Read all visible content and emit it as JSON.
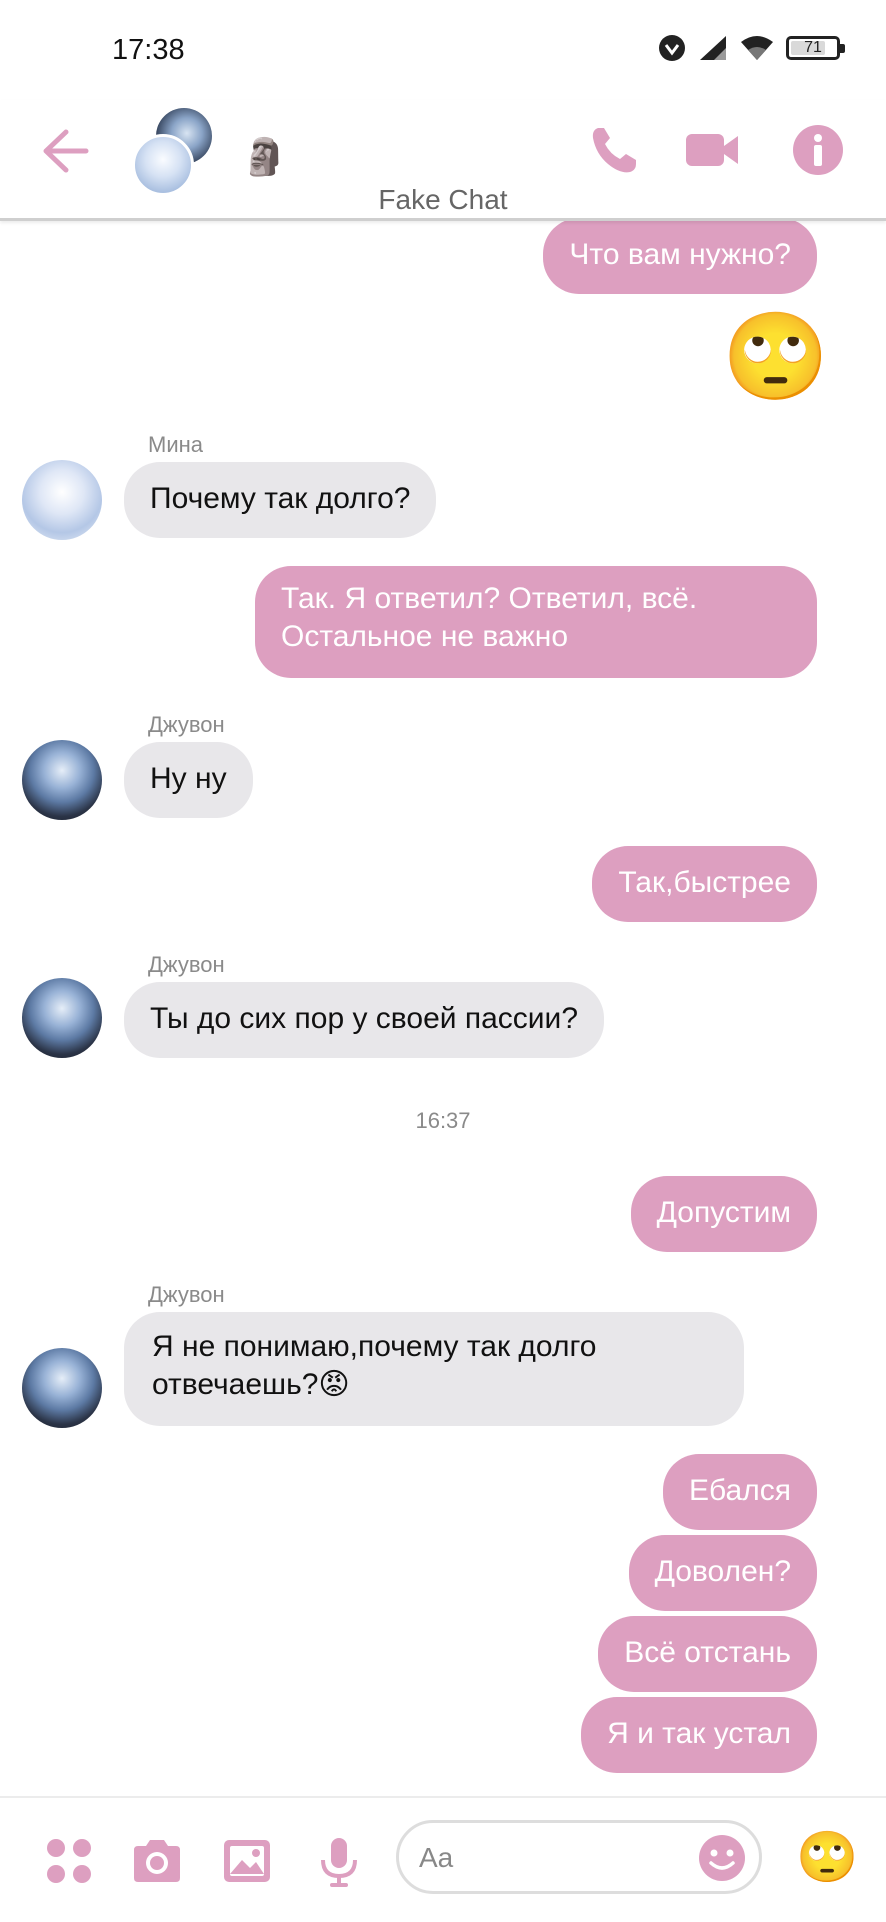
{
  "status_bar": {
    "time": "17:38",
    "battery": "71"
  },
  "header": {
    "title": "Fake Chat",
    "moai_emoji": "🗿"
  },
  "accent_color": "#dd9fc0",
  "messages": [
    {
      "dir": "out",
      "text": "Что вам нужно?"
    },
    {
      "dir": "out",
      "emoji": "🙄"
    },
    {
      "sender": "Мина",
      "dir": "in",
      "text": "Почему так долго?"
    },
    {
      "dir": "out",
      "text_line1": "Так. Я ответил? Ответил, всё.",
      "text_line2": "Остальное не важно"
    },
    {
      "sender": "Джувон",
      "dir": "in",
      "text": "Ну ну"
    },
    {
      "dir": "out",
      "text": "Так,быстрее"
    },
    {
      "sender": "Джувон",
      "dir": "in",
      "text": "Ты до сих пор у своей пассии?"
    },
    {
      "timestamp": "16:37"
    },
    {
      "dir": "out",
      "text": "Допустим"
    },
    {
      "sender": "Джувон",
      "dir": "in",
      "text_line1": "Я не понимаю,почему так долго",
      "text_line2": "отвечаешь?😡"
    },
    {
      "dir": "out",
      "text": "Ебался"
    },
    {
      "dir": "out",
      "text": "Доволен?"
    },
    {
      "dir": "out",
      "text": "Всё отстань"
    },
    {
      "dir": "out",
      "text": "Я и так устал"
    }
  ],
  "composer": {
    "placeholder": "Aa",
    "quick_emoji": "🙄"
  },
  "icons": [
    "back-arrow-icon",
    "phone-icon",
    "video-camera-icon",
    "info-icon",
    "apps-grid-icon",
    "camera-icon",
    "gallery-icon",
    "microphone-icon",
    "smiley-icon"
  ]
}
